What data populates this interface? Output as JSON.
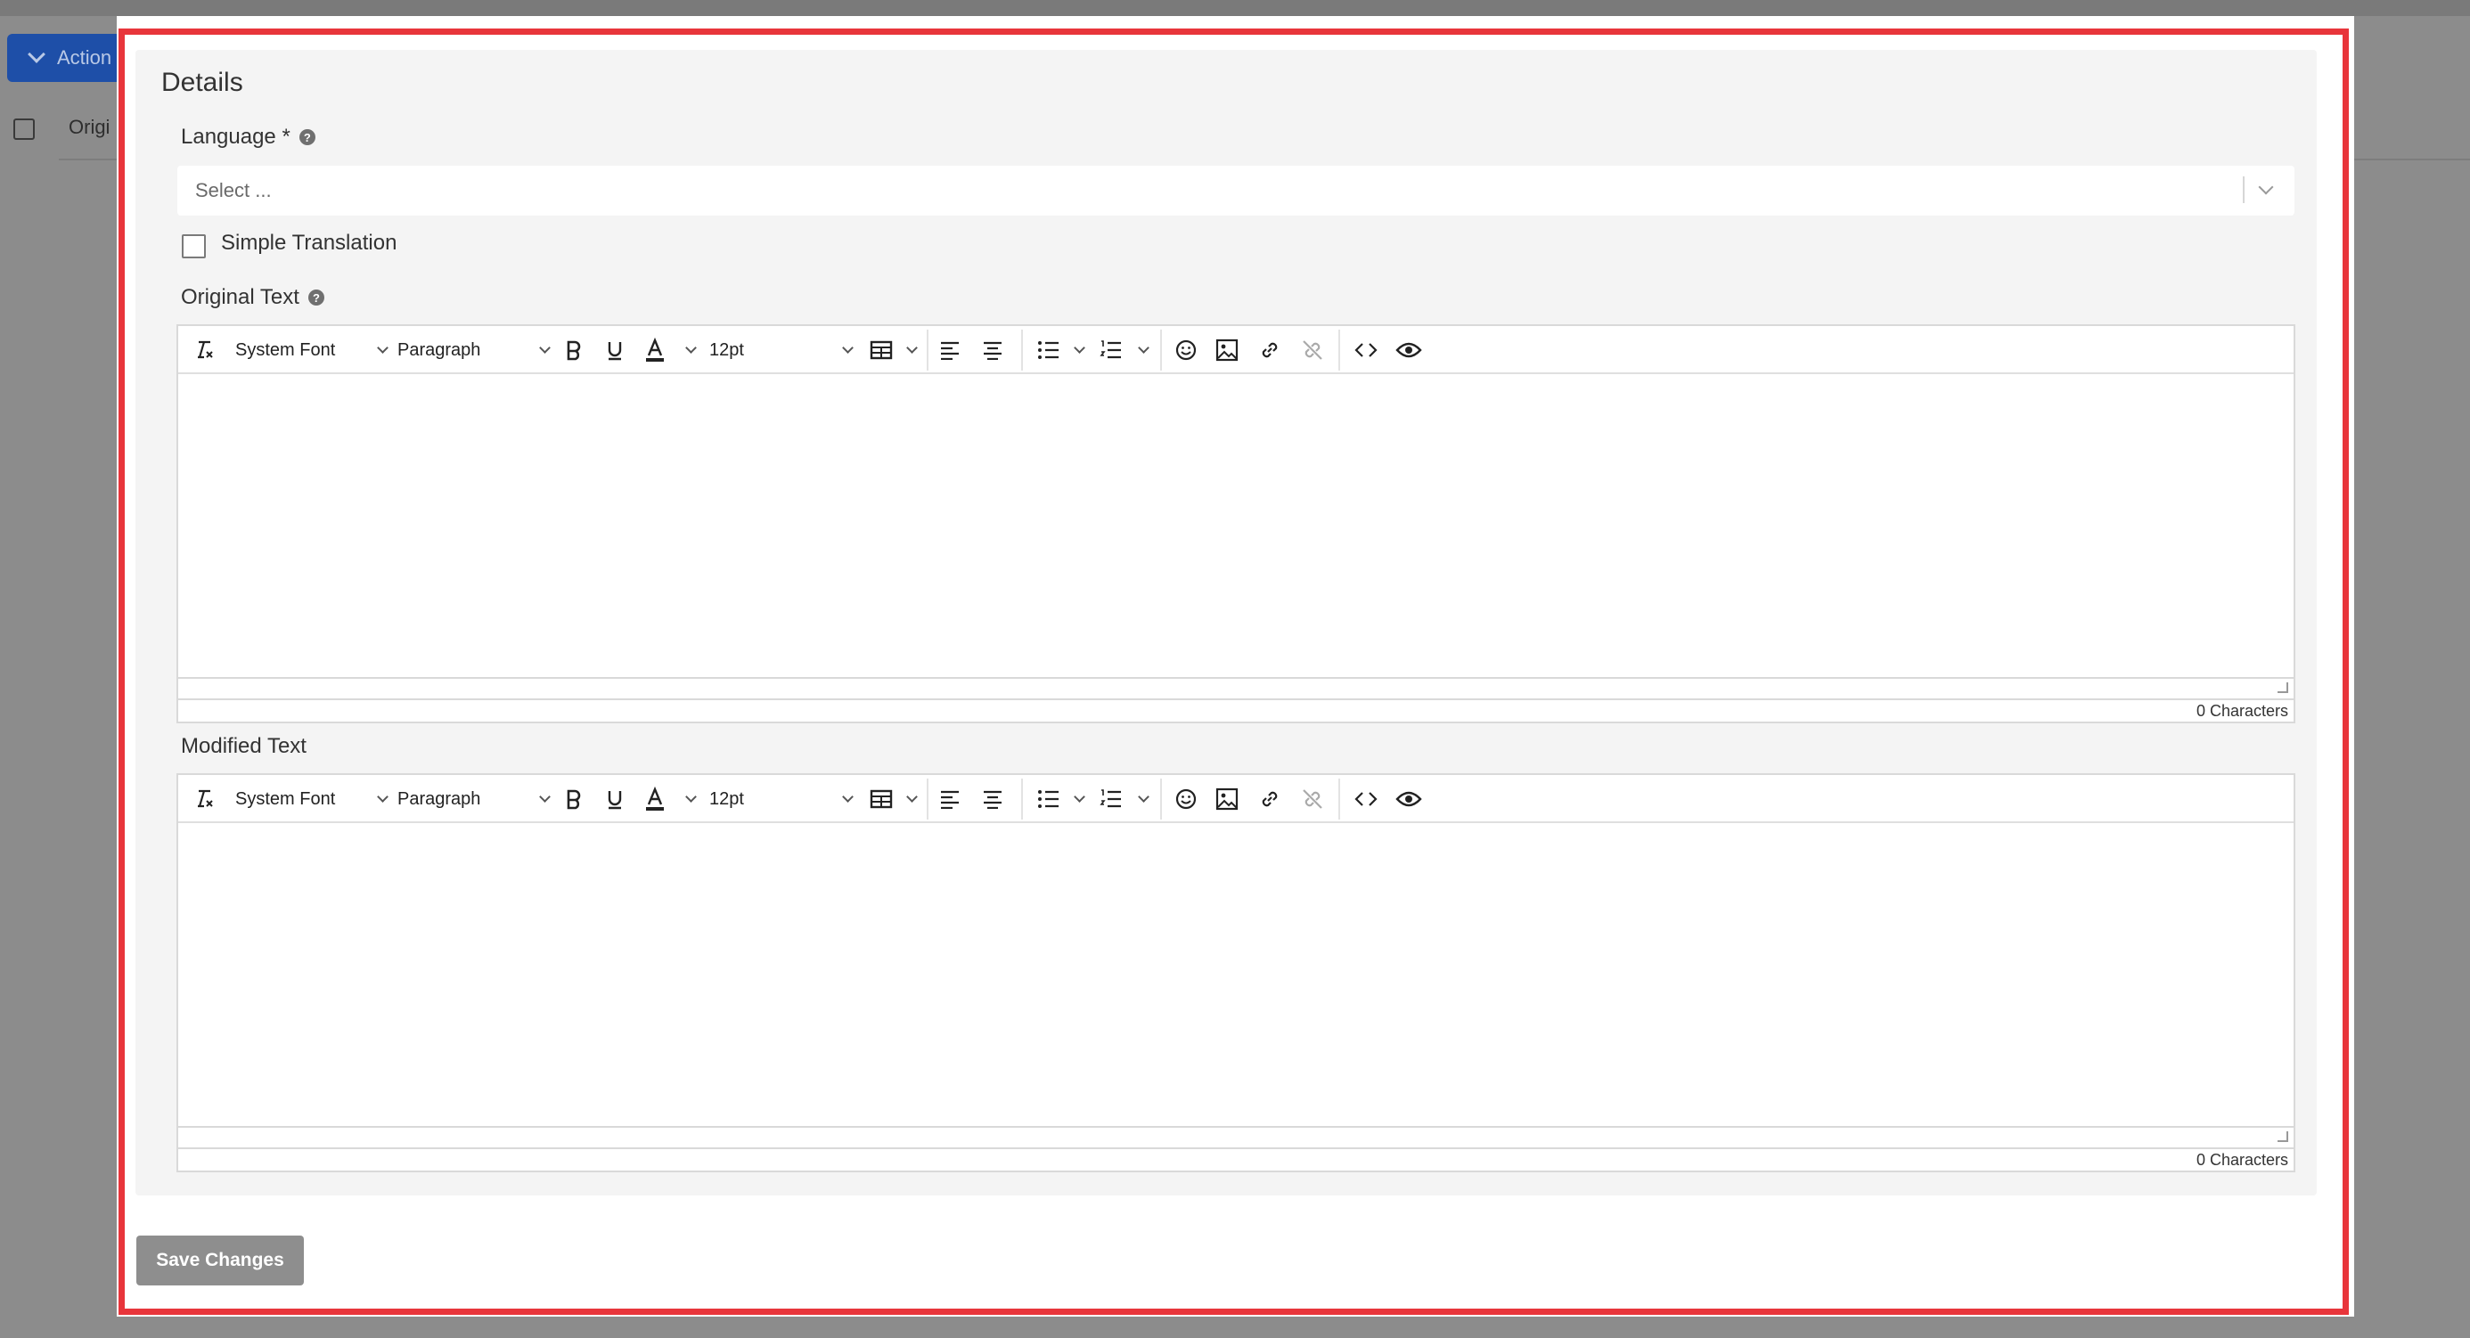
{
  "background": {
    "actions_button_label": "Action",
    "column_label": "Origi"
  },
  "modal": {
    "section_title": "Details",
    "language": {
      "label": "Language *",
      "placeholder": "Select ..."
    },
    "simple_translation_label": "Simple Translation",
    "original_text": {
      "label": "Original Text",
      "char_count": "0 Characters"
    },
    "modified_text": {
      "label": "Modified Text",
      "char_count": "0 Characters"
    },
    "toolbar": {
      "font_family": "System Font",
      "block_format": "Paragraph",
      "font_size": "12pt",
      "icons": [
        "clear-formatting-icon",
        "bold-icon",
        "underline-icon",
        "text-color-icon",
        "table-icon",
        "align-left-icon",
        "align-center-icon",
        "bullet-list-icon",
        "numbered-list-icon",
        "emoji-icon",
        "image-icon",
        "link-icon",
        "unlink-icon",
        "source-code-icon",
        "preview-icon"
      ]
    },
    "save_button_label": "Save Changes"
  },
  "colors": {
    "highlight_border": "#e8353b",
    "actions_button": "#1e4fa8",
    "save_button": "#8e8e8e"
  }
}
